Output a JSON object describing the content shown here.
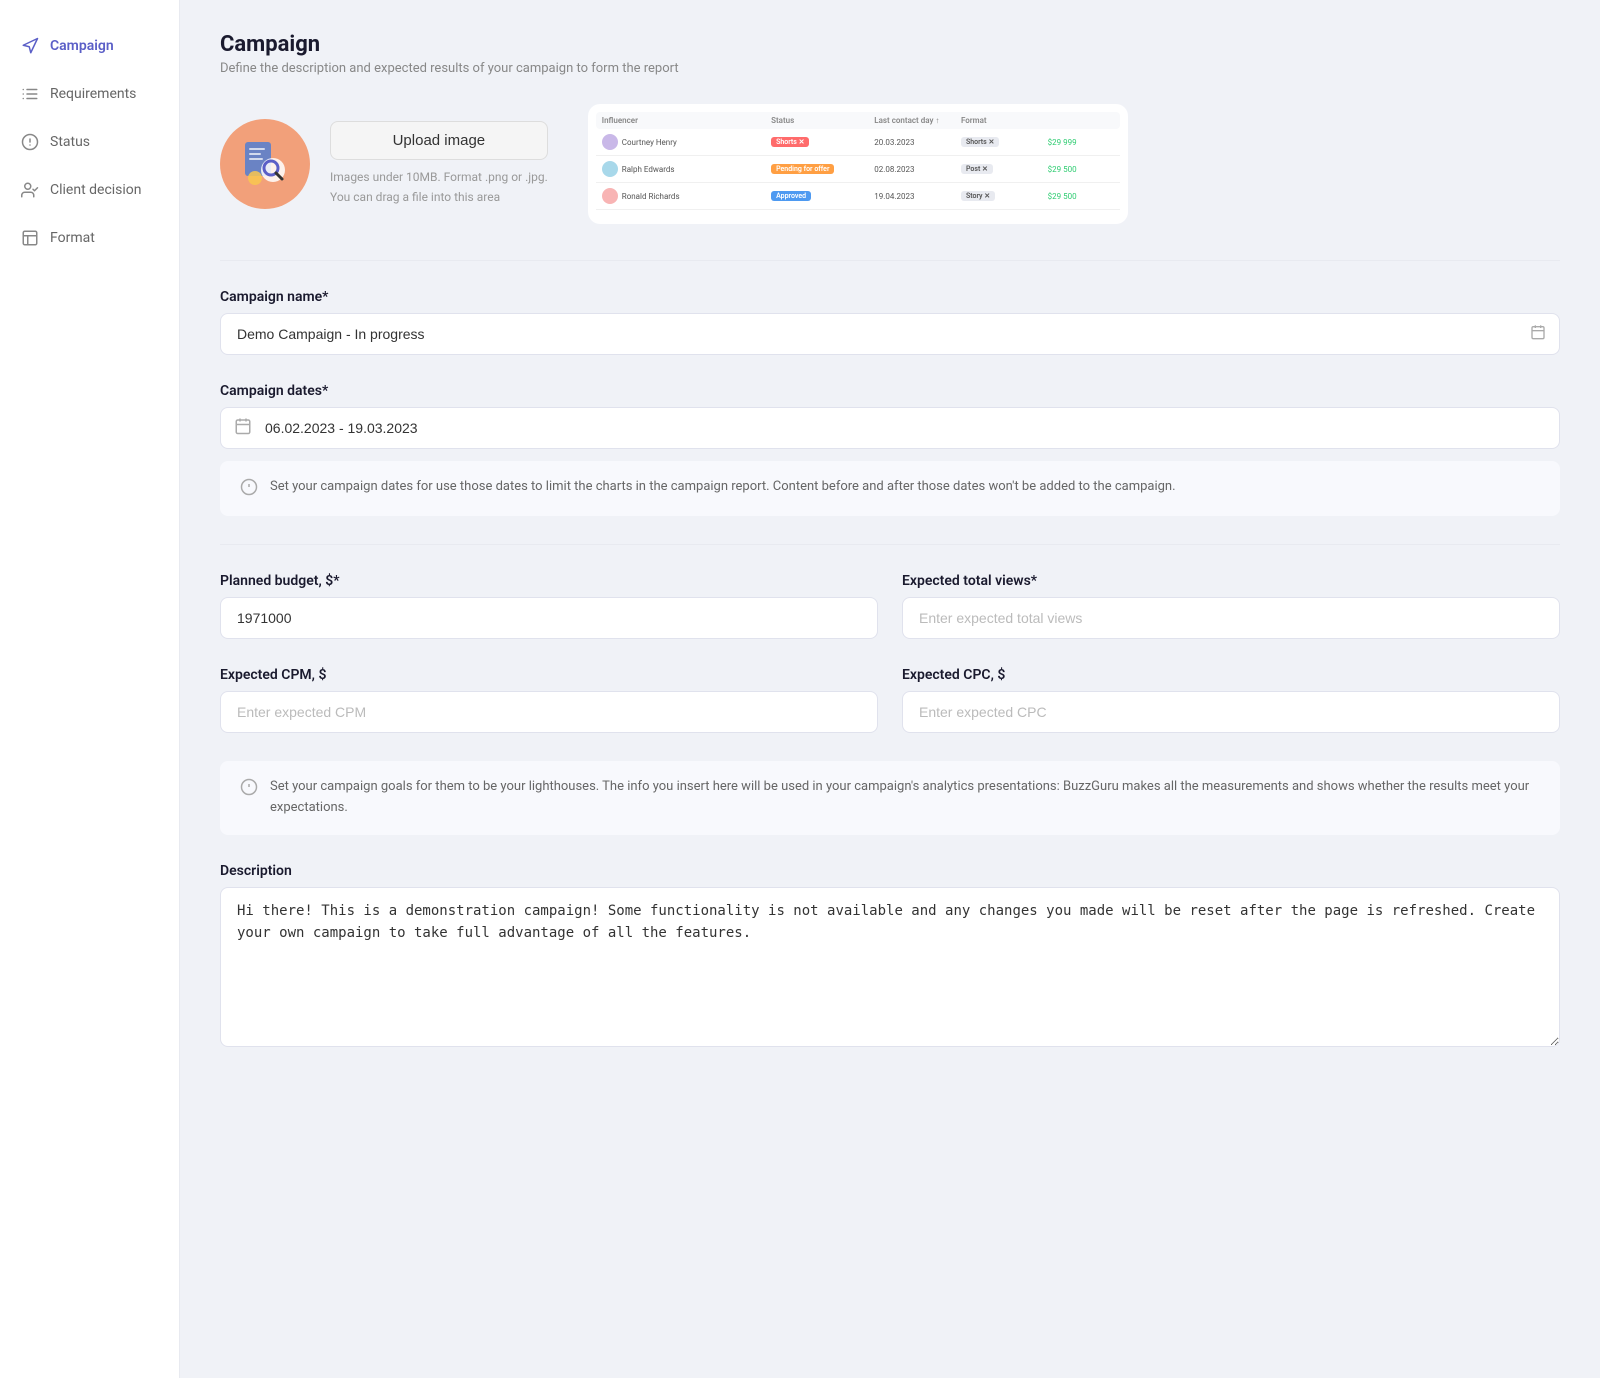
{
  "sidebar": {
    "items": [
      {
        "id": "campaign",
        "label": "Campaign",
        "icon": "megaphone",
        "active": true
      },
      {
        "id": "requirements",
        "label": "Requirements",
        "icon": "list",
        "active": false
      },
      {
        "id": "status",
        "label": "Status",
        "icon": "zap",
        "active": false
      },
      {
        "id": "client-decision",
        "label": "Client decision",
        "icon": "user-check",
        "active": false
      },
      {
        "id": "format",
        "label": "Format",
        "icon": "layout",
        "active": false
      }
    ]
  },
  "header": {
    "title": "Campaign",
    "subtitle": "Define the description and expected results of your campaign to form the report"
  },
  "upload": {
    "button_label": "Upload image",
    "hint_line1": "Images under 10MB. Format .png or .jpg.",
    "hint_line2": "You can drag a file into this area"
  },
  "preview_table": {
    "header": [
      "Influencer",
      "Status",
      "Last contact day",
      "Format",
      ""
    ],
    "rows": [
      {
        "name": "Courtney Henry",
        "status": "Shorts",
        "date": "20.03.2023",
        "format": "Shorts",
        "price": "$29 999"
      },
      {
        "name": "Ralph Edwards",
        "status": "Pending for offer",
        "date": "02.08.2023",
        "format": "Post",
        "price": "$29 500"
      },
      {
        "name": "Ronald Richards",
        "status": "Approved",
        "date": "19.04.2023",
        "format": "Story",
        "price": "$29 500"
      }
    ]
  },
  "form": {
    "campaign_name_label": "Campaign name*",
    "campaign_name_value": "Demo Campaign - In progress",
    "campaign_dates_label": "Campaign dates*",
    "campaign_dates_value": "06.02.2023 - 19.03.2023",
    "dates_info": "Set your campaign dates for use those dates to limit the charts in the campaign report. Content before and after those dates won't be added to the campaign.",
    "planned_budget_label": "Planned budget, $*",
    "planned_budget_value": "1971000",
    "expected_views_label": "Expected total views*",
    "expected_views_placeholder": "Enter expected total views",
    "expected_cpm_label": "Expected CPM, $",
    "expected_cpm_placeholder": "Enter expected CPM",
    "expected_cpc_label": "Expected CPC, $",
    "expected_cpc_placeholder": "Enter expected CPC",
    "goals_info": "Set your campaign goals for them to be your lighthouses. The info you insert here will be used in your campaign's analytics presentations: BuzzGuru makes all the measurements and shows whether the results meet your expectations.",
    "description_label": "Description",
    "description_value": "Hi there! This is a demonstration campaign! Some functionality is not available and any changes you made will be reset after the page is refreshed. Create your own campaign to take full advantage of all the features."
  }
}
